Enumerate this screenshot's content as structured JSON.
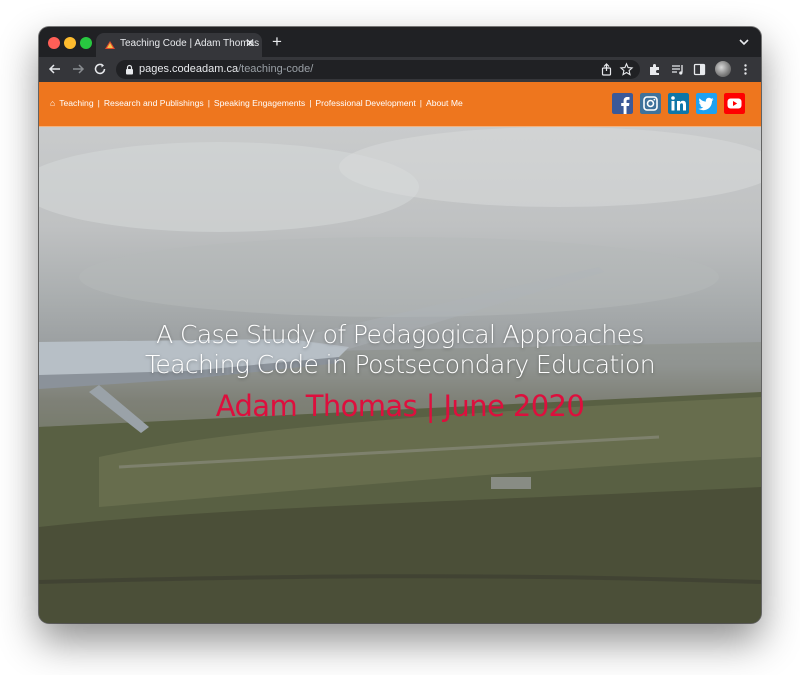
{
  "browser": {
    "tab": {
      "title": "Teaching Code | Adam Thomas",
      "close_glyph": "✕",
      "favicon": "site-favicon-icon"
    },
    "new_tab_glyph": "+",
    "url": {
      "host": "pages.codeadam.ca",
      "path": "/teaching-code/"
    },
    "icons": [
      "back-icon",
      "forward-icon",
      "reload-icon",
      "lock-icon",
      "share-icon",
      "bookmark-star-icon",
      "extensions-icon",
      "media-control-icon",
      "side-panel-icon",
      "profile-avatar",
      "more-menu-icon",
      "tab-search-icon"
    ]
  },
  "site_nav": {
    "home_glyph": "⌂",
    "items": [
      {
        "label": "Teaching"
      },
      {
        "label": "Research and Publishings"
      },
      {
        "label": "Speaking Engagements"
      },
      {
        "label": "Professional Development"
      },
      {
        "label": "About Me"
      }
    ],
    "separator": "|"
  },
  "social": [
    {
      "name": "facebook-icon",
      "color": "#3b5998"
    },
    {
      "name": "instagram-icon",
      "color": "#3f729b"
    },
    {
      "name": "linkedin-icon",
      "color": "#0e76a8"
    },
    {
      "name": "twitter-icon",
      "color": "#1da1f2"
    },
    {
      "name": "youtube-icon",
      "color": "#ff0000"
    }
  ],
  "hero": {
    "line1": "A Case Study of Pedagogical Approaches",
    "line2": "Teaching Code in Postsecondary Education",
    "author": "Adam Thomas | June 2020"
  },
  "colors": {
    "nav_bar": "#ee761e",
    "author_text": "#dd0f3d",
    "browser_frame": "#202124",
    "toolbar": "#35363a"
  }
}
